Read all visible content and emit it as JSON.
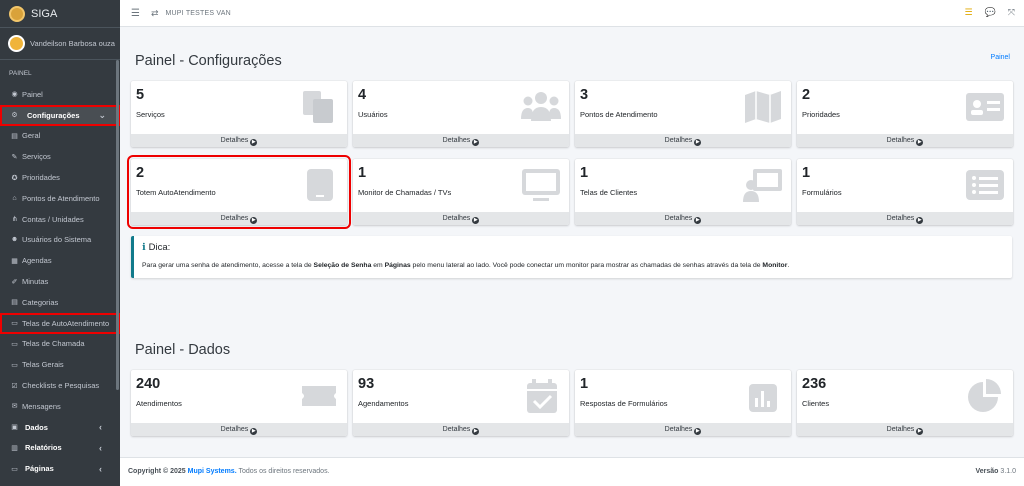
{
  "brand": {
    "name": "SIGA"
  },
  "user": {
    "name": "Vandeilson Barbosa ouza"
  },
  "nav": {
    "header": "PAINEL",
    "items": [
      {
        "label": "Painel",
        "icon": "gauge-icon"
      },
      {
        "label": "Configurações",
        "icon": "gears-icon"
      },
      {
        "label": "Geral",
        "icon": "printer-icon"
      },
      {
        "label": "Serviços",
        "icon": "wrench-icon"
      },
      {
        "label": "Prioridades",
        "icon": "star-icon"
      },
      {
        "label": "Pontos de Atendimento",
        "icon": "home-icon"
      },
      {
        "label": "Contas / Unidades",
        "icon": "sitemap-icon"
      },
      {
        "label": "Usuários do Sistema",
        "icon": "users-icon"
      },
      {
        "label": "Agendas",
        "icon": "calendar-icon"
      },
      {
        "label": "Minutas",
        "icon": "edit-icon"
      },
      {
        "label": "Categorias",
        "icon": "list-icon"
      },
      {
        "label": "Telas de AutoAtendimento",
        "icon": "desktop-icon"
      },
      {
        "label": "Telas de Chamada",
        "icon": "desktop-icon"
      },
      {
        "label": "Telas Gerais",
        "icon": "desktop-icon"
      },
      {
        "label": "Checklists e Pesquisas",
        "icon": "checklist-icon"
      },
      {
        "label": "Mensagens",
        "icon": "envelope-icon"
      },
      {
        "label": "Dados",
        "icon": "database-icon"
      },
      {
        "label": "Relatórios",
        "icon": "chart-icon"
      },
      {
        "label": "Páginas",
        "icon": "monitor-icon"
      }
    ]
  },
  "topbar": {
    "title": "MUPI TESTES VAN"
  },
  "main": {
    "title": "Painel - Configurações",
    "breadcrumb": "Painel",
    "cards": [
      {
        "value": "5",
        "label": "Serviços",
        "footer": "Detalhes",
        "icon": "copy-icon"
      },
      {
        "value": "4",
        "label": "Usuários",
        "footer": "Detalhes",
        "icon": "users-icon"
      },
      {
        "value": "3",
        "label": "Pontos de Atendimento",
        "footer": "Detalhes",
        "icon": "map-icon"
      },
      {
        "value": "2",
        "label": "Prioridades",
        "footer": "Detalhes",
        "icon": "id-card-icon"
      },
      {
        "value": "2",
        "label": "Totem AutoAtendimento",
        "footer": "Detalhes",
        "icon": "tablet-icon"
      },
      {
        "value": "1",
        "label": "Monitor de Chamadas / TVs",
        "footer": "Detalhes",
        "icon": "monitor-icon"
      },
      {
        "value": "1",
        "label": "Telas de Clientes",
        "footer": "Detalhes",
        "icon": "chalkboard-user-icon"
      },
      {
        "value": "1",
        "label": "Formulários",
        "footer": "Detalhes",
        "icon": "list-alt-icon"
      }
    ],
    "tip": {
      "title": "Dica:",
      "text_1": "Para gerar uma senha de atendimento, acesse a tela de ",
      "bold_1": "Seleção de Senha",
      "text_2": " em ",
      "bold_2": "Páginas",
      "text_3": " pelo menu lateral ao lado. Você pode conectar um monitor para mostrar as chamadas de senhas através da tela de ",
      "bold_3": "Monitor",
      "text_4": "."
    },
    "data_title": "Painel - Dados",
    "data_cards": [
      {
        "value": "240",
        "label": "Atendimentos",
        "footer": "Detalhes",
        "icon": "ticket-icon"
      },
      {
        "value": "93",
        "label": "Agendamentos",
        "footer": "Detalhes",
        "icon": "calendar-check-icon"
      },
      {
        "value": "1",
        "label": "Respostas de Formulários",
        "footer": "Detalhes",
        "icon": "bar-chart-icon"
      },
      {
        "value": "236",
        "label": "Clientes",
        "footer": "Detalhes",
        "icon": "pie-chart-icon"
      }
    ]
  },
  "footer": {
    "copyright_prefix": "Copyright © 2025",
    "company": "Mupi Systems.",
    "rights": "Todos os direitos reservados.",
    "version_label": "Versão",
    "version": "3.1.0"
  }
}
